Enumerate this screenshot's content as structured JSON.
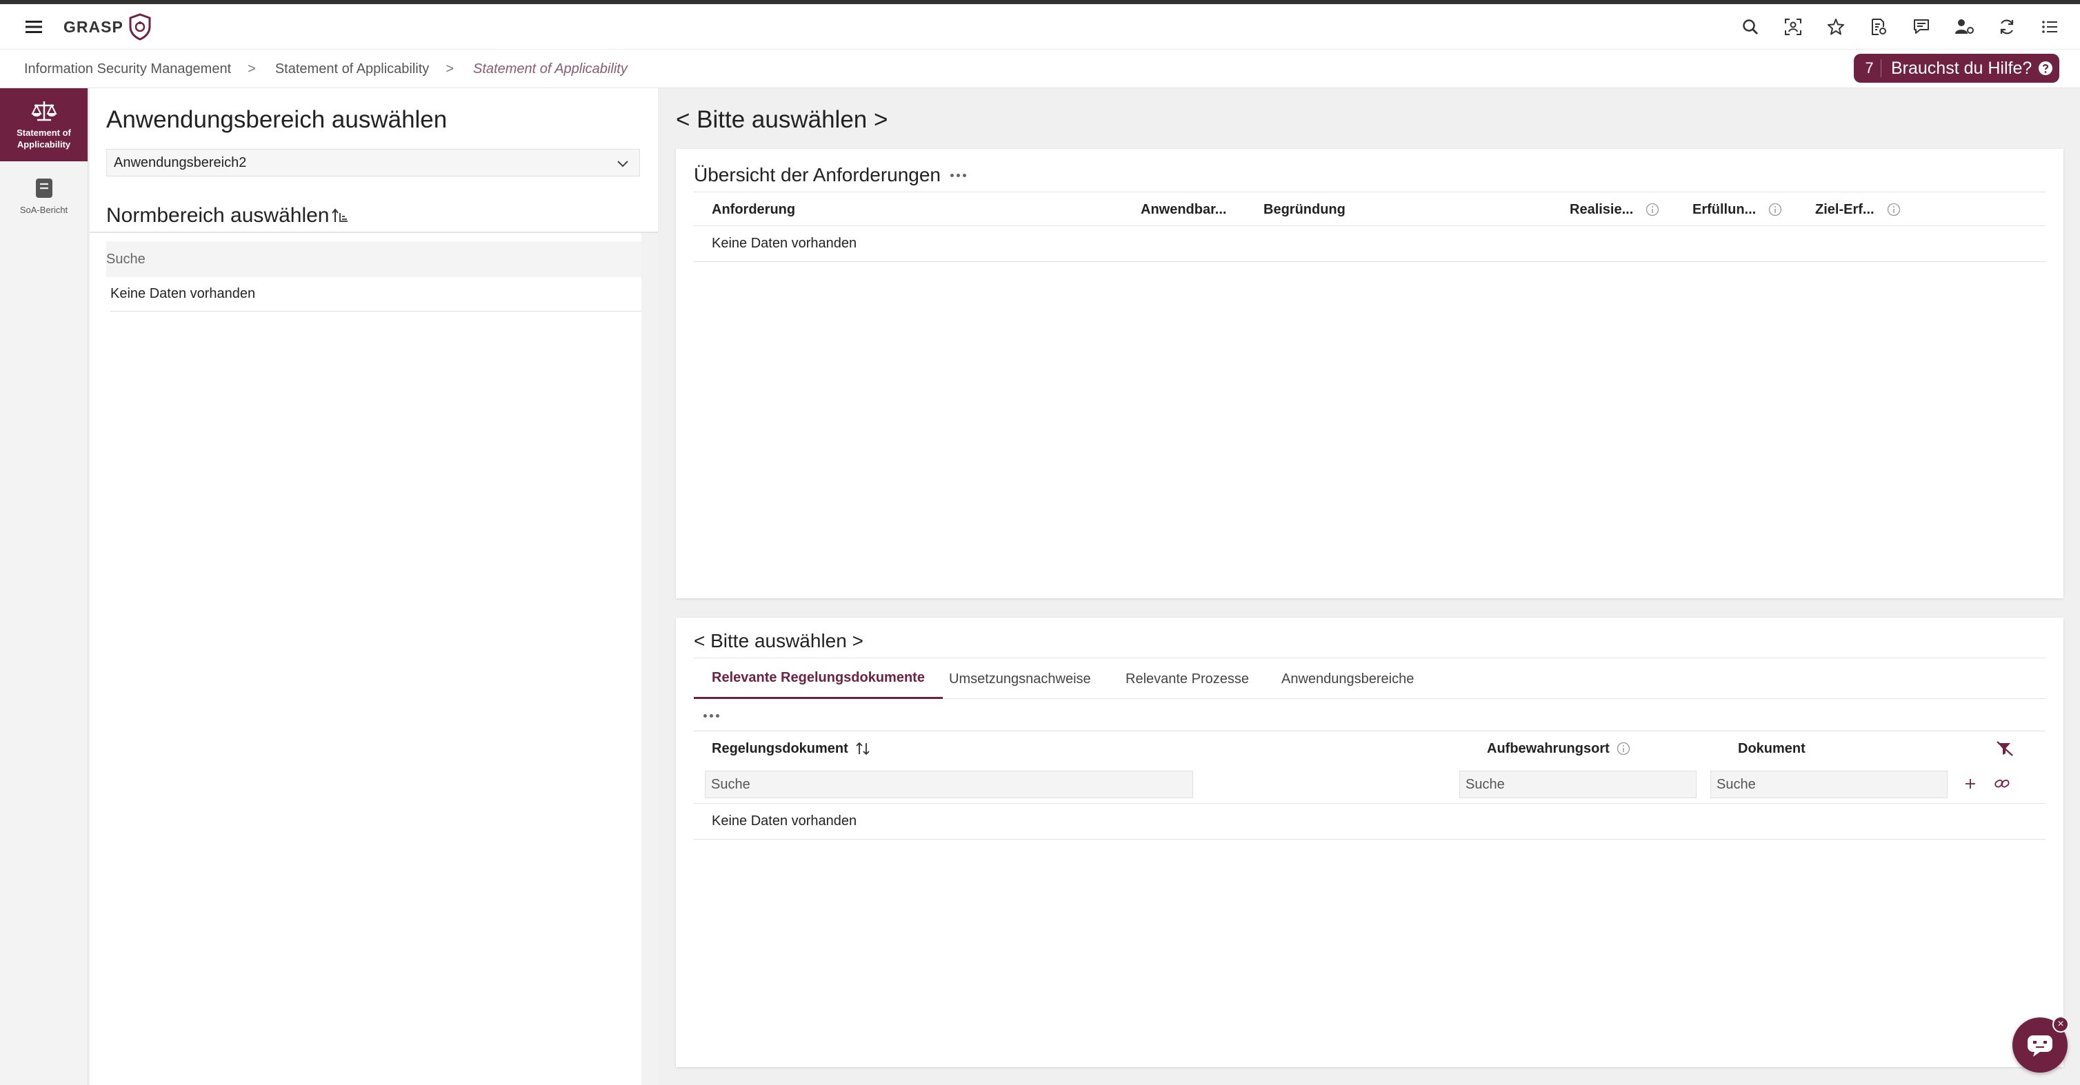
{
  "app": {
    "logo_text": "GRASP"
  },
  "breadcrumb": {
    "items": [
      "Information Security Management",
      "Statement of Applicability",
      "Statement of Applicability"
    ],
    "separator": ">"
  },
  "help": {
    "count": "7",
    "label": "Brauchst du Hilfe?"
  },
  "sidenav": {
    "items": [
      {
        "label": "Statement of Applicability",
        "icon": "scale-icon"
      },
      {
        "label": "SoA-Bericht",
        "icon": "report-icon"
      }
    ]
  },
  "left": {
    "title": "Anwendungsbereich auswählen",
    "selected_scope": "Anwendungsbereich2",
    "subtitle": "Normbereich auswählen",
    "search_placeholder": "Suche",
    "empty": "Keine Daten vorhanden"
  },
  "main": {
    "title": "< Bitte auswählen >",
    "overview": {
      "title": "Übersicht der Anforderungen",
      "columns": [
        "Anforderung",
        "Anwendbar...",
        "Begründung",
        "Realisie...",
        "Erfüllun...",
        "Ziel-Erf..."
      ],
      "empty": "Keine Daten vorhanden"
    },
    "detail": {
      "title": "< Bitte auswählen >",
      "tabs": [
        "Relevante Regelungsdokumente",
        "Umsetzungsnachweise",
        "Relevante Prozesse",
        "Anwendungsbereiche"
      ],
      "columns": [
        "Regelungsdokument",
        "Aufbewahrungsort",
        "Dokument"
      ],
      "search_placeholder": "Suche",
      "empty": "Keine Daten vorhanden"
    }
  },
  "colors": {
    "accent": "#6e2140"
  }
}
